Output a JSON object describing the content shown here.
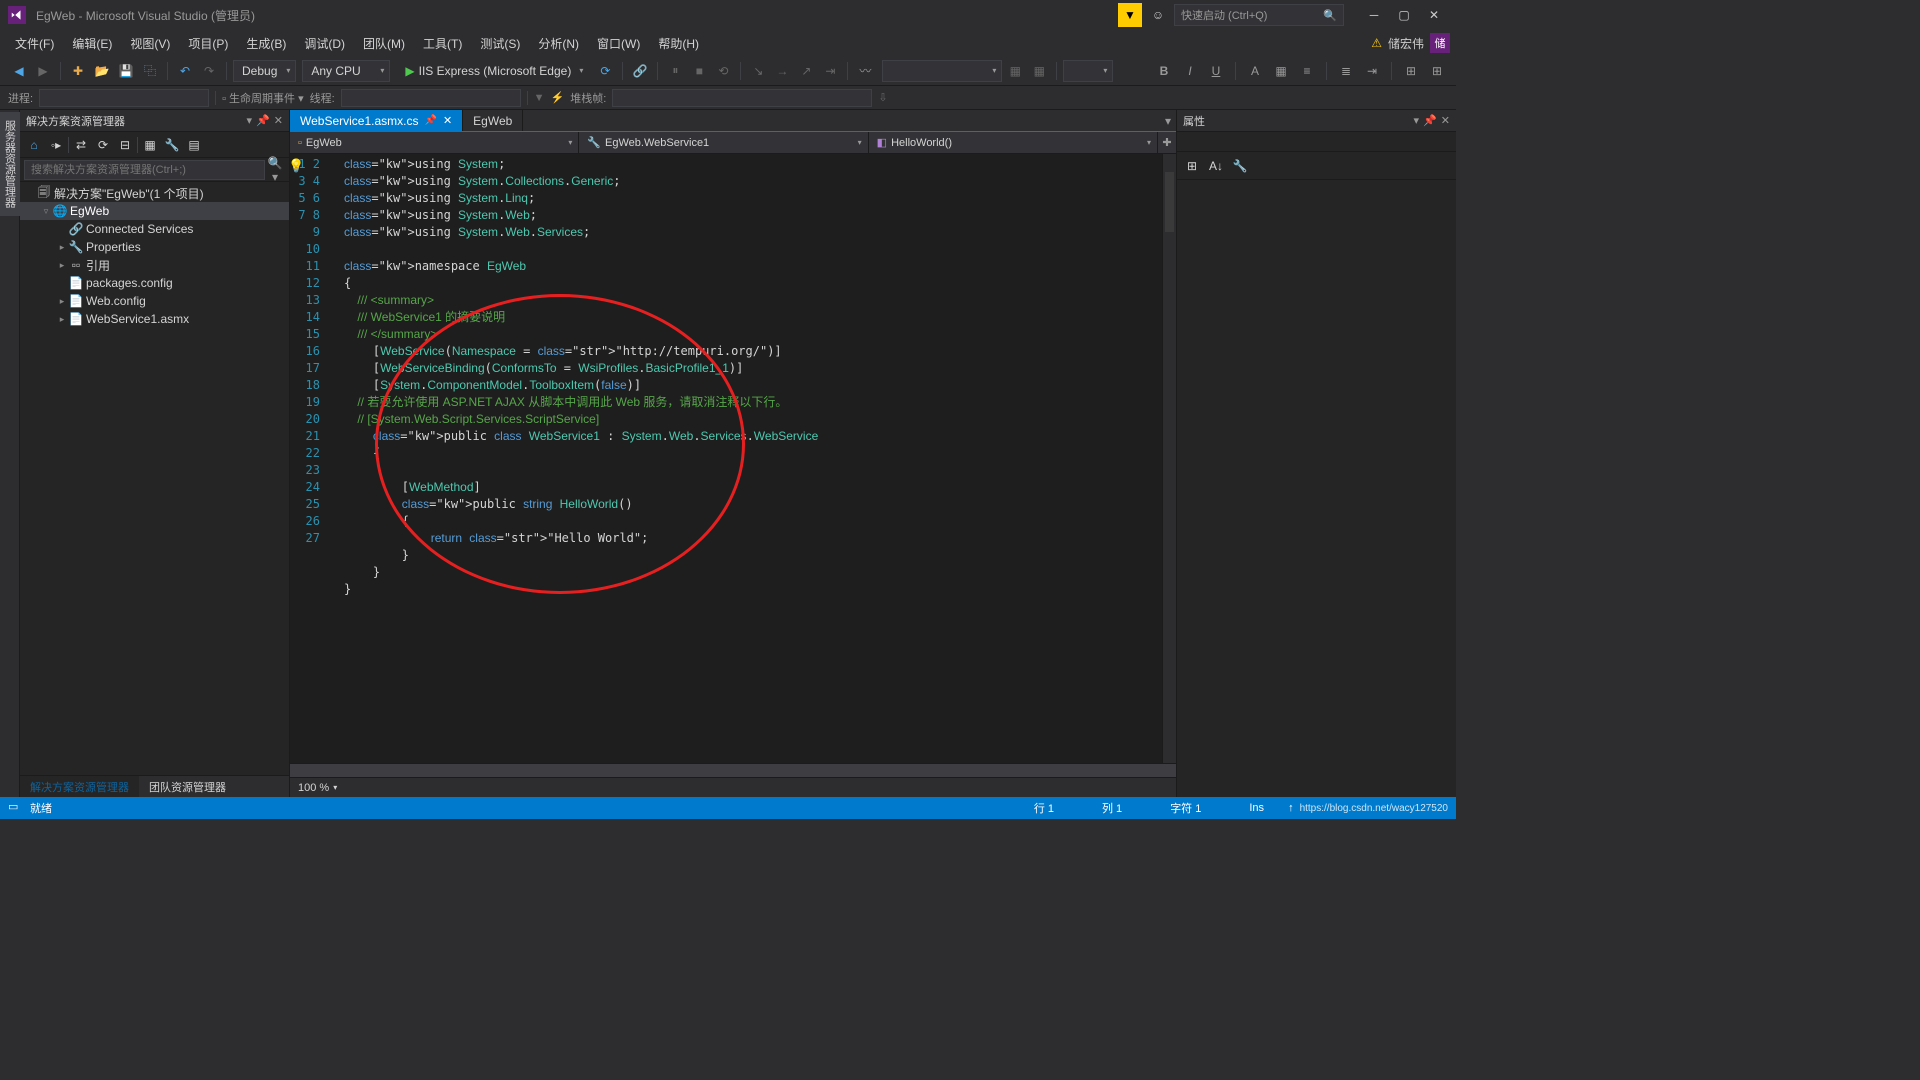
{
  "title": "EgWeb - Microsoft Visual Studio (管理员)",
  "quickLaunch": "快速启动 (Ctrl+Q)",
  "menus": [
    "文件(F)",
    "编辑(E)",
    "视图(V)",
    "项目(P)",
    "生成(B)",
    "调试(D)",
    "团队(M)",
    "工具(T)",
    "测试(S)",
    "分析(N)",
    "窗口(W)",
    "帮助(H)"
  ],
  "user": "储宏伟",
  "avatar": "储",
  "toolbar": {
    "config": "Debug",
    "platform": "Any CPU",
    "run": "IIS Express (Microsoft Edge)"
  },
  "subtoolbar": {
    "process": "进程:",
    "lifecycle": "生命周期事件",
    "thread": "线程:",
    "stack": "堆栈帧:"
  },
  "sideLabel": "服务器资源管理器",
  "solutionPanel": {
    "title": "解决方案资源管理器",
    "search": "搜索解决方案资源管理器(Ctrl+;)",
    "items": [
      {
        "indent": 0,
        "arrow": "",
        "icon": "🗐",
        "label": "解决方案\"EgWeb\"(1 个项目)"
      },
      {
        "indent": 1,
        "arrow": "▿",
        "icon": "🌐",
        "label": "EgWeb",
        "sel": true
      },
      {
        "indent": 2,
        "arrow": "",
        "icon": "🔗",
        "label": "Connected Services"
      },
      {
        "indent": 2,
        "arrow": "▸",
        "icon": "🔧",
        "label": "Properties"
      },
      {
        "indent": 2,
        "arrow": "▸",
        "icon": "▫▫",
        "label": "引用"
      },
      {
        "indent": 2,
        "arrow": "",
        "icon": "📄",
        "label": "packages.config"
      },
      {
        "indent": 2,
        "arrow": "▸",
        "icon": "📄",
        "label": "Web.config"
      },
      {
        "indent": 2,
        "arrow": "▸",
        "icon": "📄",
        "label": "WebService1.asmx"
      }
    ],
    "bottomTabs": [
      "解决方案资源管理器",
      "团队资源管理器"
    ]
  },
  "docTabs": [
    {
      "label": "WebService1.asmx.cs",
      "active": true,
      "pinned": true
    },
    {
      "label": "EgWeb",
      "active": false
    }
  ],
  "navCombos": [
    "EgWeb",
    "EgWeb.WebService1",
    "HelloWorld()"
  ],
  "code": {
    "lines": [
      "using System;",
      "using System.Collections.Generic;",
      "using System.Linq;",
      "using System.Web;",
      "using System.Web.Services;",
      "",
      "namespace EgWeb",
      "{",
      "    /// <summary>",
      "    /// WebService1 的摘要说明",
      "    /// </summary>",
      "    [WebService(Namespace = \"http://tempuri.org/\")]",
      "    [WebServiceBinding(ConformsTo = WsiProfiles.BasicProfile1_1)]",
      "    [System.ComponentModel.ToolboxItem(false)]",
      "    // 若要允许使用 ASP.NET AJAX 从脚本中调用此 Web 服务，请取消注释以下行。",
      "    // [System.Web.Script.Services.ScriptService]",
      "    public class WebService1 : System.Web.Services.WebService",
      "    {",
      "",
      "        [WebMethod]",
      "        public string HelloWorld()",
      "        {",
      "            return \"Hello World\";",
      "        }",
      "    }",
      "}",
      ""
    ]
  },
  "editorStatus": {
    "zoom": "100 %"
  },
  "propsPanel": {
    "title": "属性"
  },
  "statusbar": {
    "ready": "就绪",
    "line": "行 1",
    "col": "列 1",
    "char": "字符 1",
    "ins": "Ins",
    "watermark": "https://blog.csdn.net/wacy127520"
  }
}
